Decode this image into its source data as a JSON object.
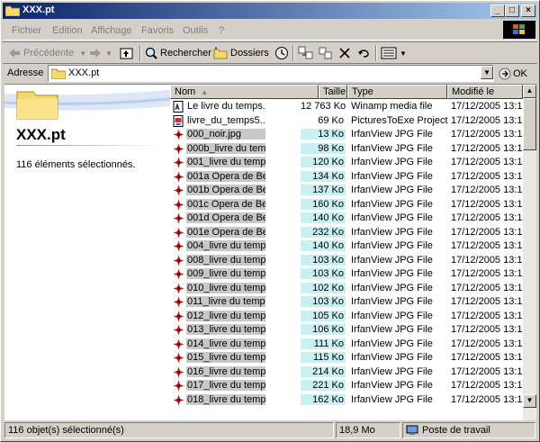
{
  "window": {
    "title": "XXX.pt"
  },
  "menu": [
    "Fichier",
    "Edition",
    "Affichage",
    "Favoris",
    "Outils",
    "?"
  ],
  "toolbar": {
    "back_label": "Précédente",
    "search_label": "Rechercher",
    "folders_label": "Dossiers"
  },
  "address": {
    "label": "Adresse",
    "value": "XXX.pt",
    "go_label": "OK"
  },
  "left_pane": {
    "title": "XXX.pt",
    "info": "116 éléments sélectionnés."
  },
  "columns": [
    "Nom",
    "Taille",
    "Type",
    "Modifié le"
  ],
  "files": [
    {
      "name": "Le livre du temps....",
      "size": "12 763 Ko",
      "type": "Winamp media file",
      "modified": "17/12/2005 13:16",
      "icon": "winamp-file-icon"
    },
    {
      "name": "livre_du_temps5....",
      "size": "69 Ko",
      "type": "PicturesToExe Project",
      "modified": "17/12/2005 13:16",
      "icon": "pte-project-icon"
    },
    {
      "name": "000_noir.jpg",
      "size": "13 Ko",
      "type": "IrfanView JPG File",
      "modified": "17/12/2005 13:16",
      "icon": "irfanview-icon"
    },
    {
      "name": "000b_livre du temp...",
      "size": "98 Ko",
      "type": "IrfanView JPG File",
      "modified": "17/12/2005 13:16",
      "icon": "irfanview-icon"
    },
    {
      "name": "001_livre du temp...",
      "size": "120 Ko",
      "type": "IrfanView JPG File",
      "modified": "17/12/2005 13:16",
      "icon": "irfanview-icon"
    },
    {
      "name": "001a Opera de Be...",
      "size": "134 Ko",
      "type": "IrfanView JPG File",
      "modified": "17/12/2005 13:16",
      "icon": "irfanview-icon"
    },
    {
      "name": "001b Opera de Be...",
      "size": "137 Ko",
      "type": "IrfanView JPG File",
      "modified": "17/12/2005 13:16",
      "icon": "irfanview-icon"
    },
    {
      "name": "001c Opera de Bei...",
      "size": "160 Ko",
      "type": "IrfanView JPG File",
      "modified": "17/12/2005 13:16",
      "icon": "irfanview-icon"
    },
    {
      "name": "001d Opera de Bei...",
      "size": "140 Ko",
      "type": "IrfanView JPG File",
      "modified": "17/12/2005 13:16",
      "icon": "irfanview-icon"
    },
    {
      "name": "001e Opera de Be...",
      "size": "232 Ko",
      "type": "IrfanView JPG File",
      "modified": "17/12/2005 13:16",
      "icon": "irfanview-icon"
    },
    {
      "name": "004_livre du temp...",
      "size": "140 Ko",
      "type": "IrfanView JPG File",
      "modified": "17/12/2005 13:16",
      "icon": "irfanview-icon"
    },
    {
      "name": "008_livre du temp...",
      "size": "103 Ko",
      "type": "IrfanView JPG File",
      "modified": "17/12/2005 13:16",
      "icon": "irfanview-icon"
    },
    {
      "name": "009_livre du temp...",
      "size": "103 Ko",
      "type": "IrfanView JPG File",
      "modified": "17/12/2005 13:16",
      "icon": "irfanview-icon"
    },
    {
      "name": "010_livre du temp...",
      "size": "102 Ko",
      "type": "IrfanView JPG File",
      "modified": "17/12/2005 13:16",
      "icon": "irfanview-icon"
    },
    {
      "name": "011_livre du temp...",
      "size": "103 Ko",
      "type": "IrfanView JPG File",
      "modified": "17/12/2005 13:16",
      "icon": "irfanview-icon"
    },
    {
      "name": "012_livre du temp...",
      "size": "105 Ko",
      "type": "IrfanView JPG File",
      "modified": "17/12/2005 13:16",
      "icon": "irfanview-icon"
    },
    {
      "name": "013_livre du temp...",
      "size": "106 Ko",
      "type": "IrfanView JPG File",
      "modified": "17/12/2005 13:16",
      "icon": "irfanview-icon"
    },
    {
      "name": "014_livre du temp...",
      "size": "111 Ko",
      "type": "IrfanView JPG File",
      "modified": "17/12/2005 13:16",
      "icon": "irfanview-icon"
    },
    {
      "name": "015_livre du temp...",
      "size": "115 Ko",
      "type": "IrfanView JPG File",
      "modified": "17/12/2005 13:16",
      "icon": "irfanview-icon"
    },
    {
      "name": "016_livre du temp...",
      "size": "214 Ko",
      "type": "IrfanView JPG File",
      "modified": "17/12/2005 13:16",
      "icon": "irfanview-icon"
    },
    {
      "name": "017_livre du temp...",
      "size": "221 Ko",
      "type": "IrfanView JPG File",
      "modified": "17/12/2005 13:16",
      "icon": "irfanview-icon"
    },
    {
      "name": "018_livre du temp...",
      "size": "162 Ko",
      "type": "IrfanView JPG File",
      "modified": "17/12/2005 13:16",
      "icon": "irfanview-icon"
    }
  ],
  "status": {
    "selection": "116 objet(s) sélectionné(s)",
    "size": "18,9 Mo",
    "zone": "Poste de travail"
  }
}
